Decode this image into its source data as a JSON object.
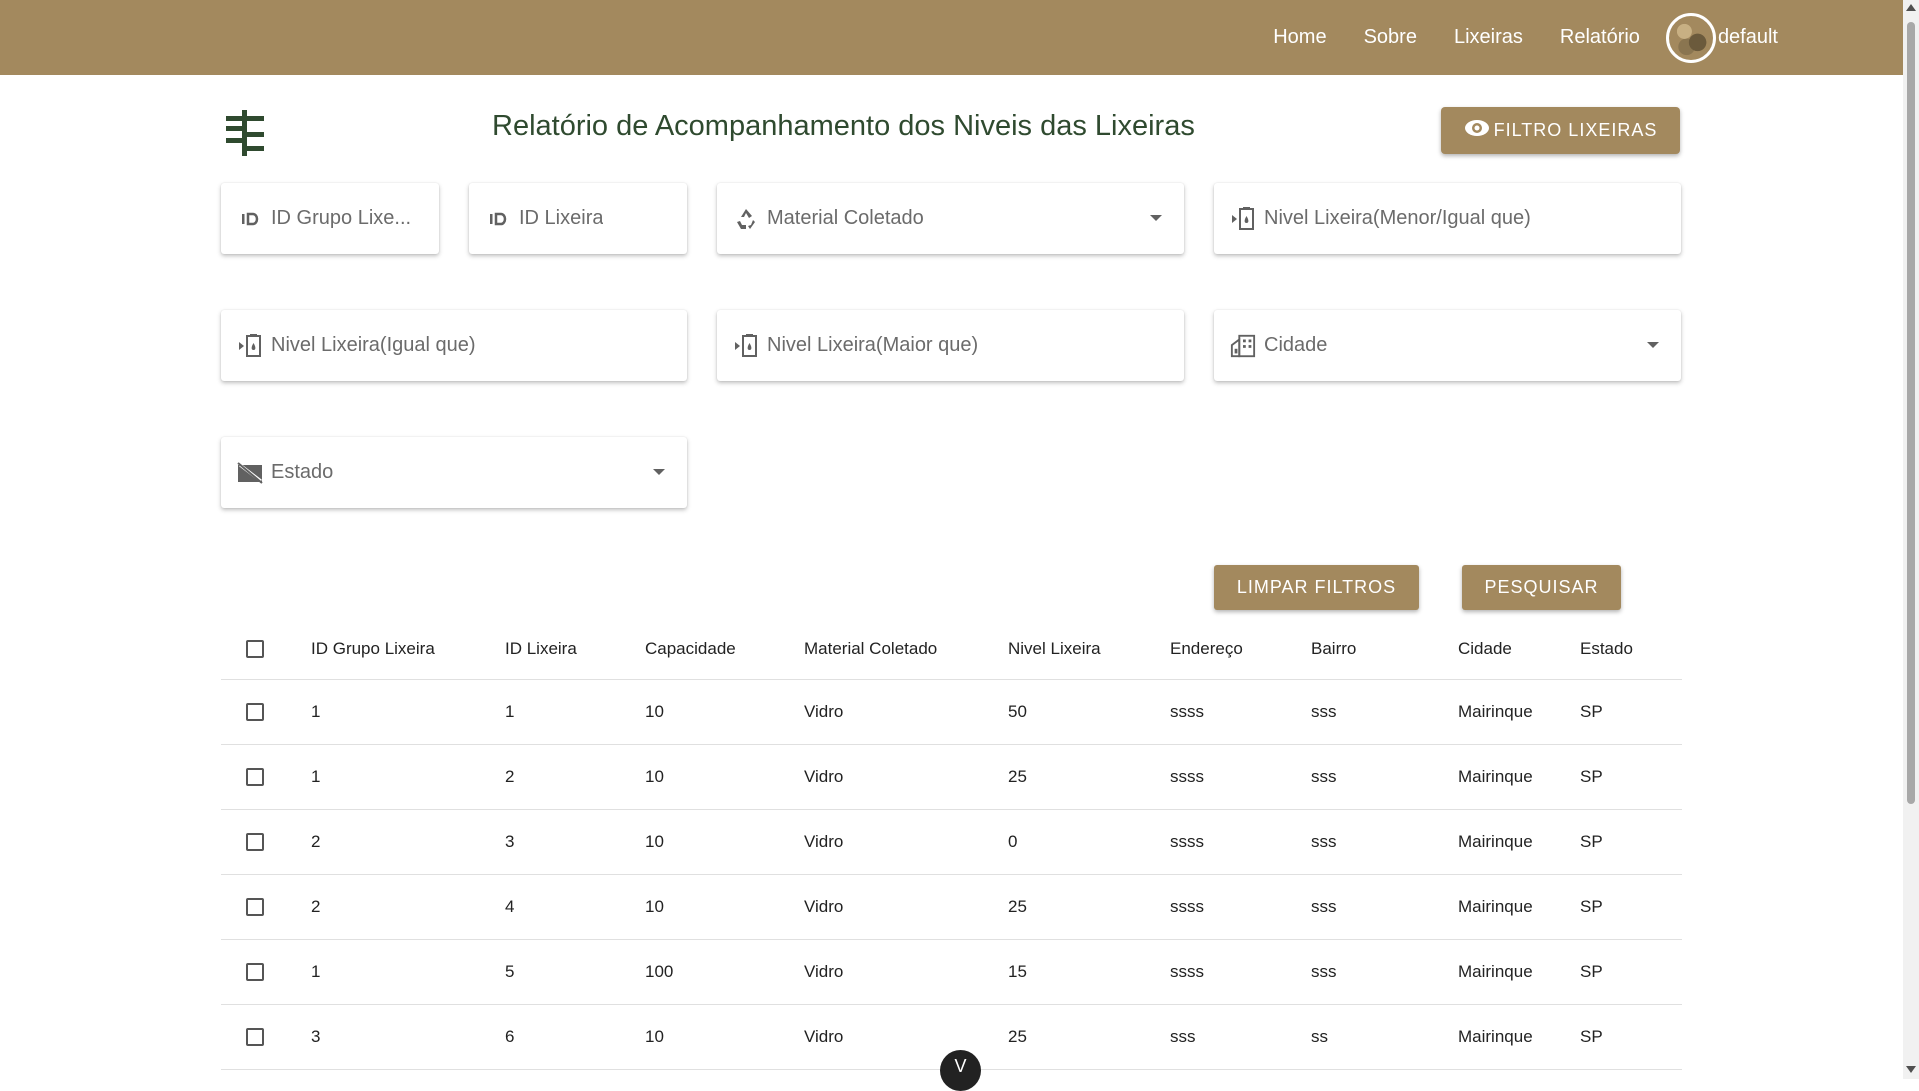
{
  "nav": {
    "links": [
      "Home",
      "Sobre",
      "Lixeiras",
      "Relatório"
    ],
    "username": "default"
  },
  "header": {
    "title": "Relatório de Acompanhamento dos Niveis das Lixeiras",
    "filter_toggle_label": "FILTRO LIXEIRAS"
  },
  "filters": {
    "id_grupo": "ID Grupo Lixe...",
    "id_lixeira": "ID Lixeira",
    "material": "Material Coletado",
    "nivel_menor": "Nivel Lixeira(Menor/Igual que)",
    "nivel_igual": "Nivel Lixeira(Igual que)",
    "nivel_maior": "Nivel Lixeira(Maior que)",
    "cidade": "Cidade",
    "estado": "Estado"
  },
  "actions": {
    "clear_label": "LIMPAR FILTROS",
    "search_label": "PESQUISAR"
  },
  "table": {
    "headers": [
      "ID Grupo Lixeira",
      "ID Lixeira",
      "Capacidade",
      "Material Coletado",
      "Nivel Lixeira",
      "Endereço",
      "Bairro",
      "Cidade",
      "Estado"
    ],
    "rows": [
      [
        "1",
        "1",
        "10",
        "Vidro",
        "50",
        "ssss",
        "sss",
        "Mairinque",
        "SP"
      ],
      [
        "1",
        "2",
        "10",
        "Vidro",
        "25",
        "ssss",
        "sss",
        "Mairinque",
        "SP"
      ],
      [
        "2",
        "3",
        "10",
        "Vidro",
        "0",
        "ssss",
        "sss",
        "Mairinque",
        "SP"
      ],
      [
        "2",
        "4",
        "10",
        "Vidro",
        "25",
        "ssss",
        "sss",
        "Mairinque",
        "SP"
      ],
      [
        "1",
        "5",
        "100",
        "Vidro",
        "15",
        "ssss",
        "sss",
        "Mairinque",
        "SP"
      ],
      [
        "3",
        "6",
        "10",
        "Vidro",
        "25",
        "sss",
        "ss",
        "Mairinque",
        "SP"
      ]
    ]
  },
  "fab_label": "V",
  "colors": {
    "brand": "#a3895e",
    "title": "#2f4a2f"
  }
}
